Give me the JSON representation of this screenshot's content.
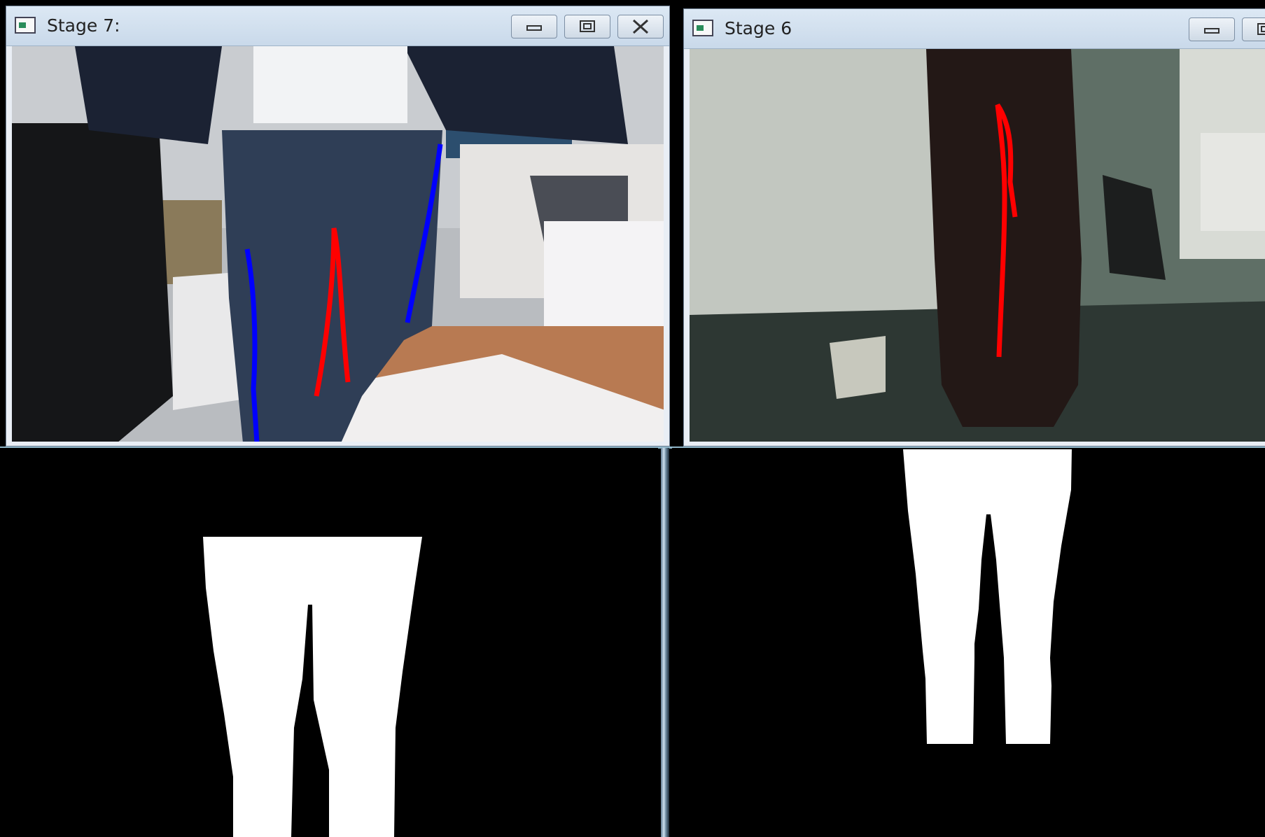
{
  "windows": [
    {
      "id": "stage7",
      "title": "Stage 7:",
      "controls": [
        "minimize",
        "maximize",
        "close"
      ]
    },
    {
      "id": "stage6",
      "title": "Stage 6",
      "controls": [
        "minimize",
        "maximize"
      ]
    }
  ],
  "colors": {
    "inner_leg_contour": "#ff0000",
    "outer_leg_contour": "#0000ff",
    "mask_foreground": "#ffffff",
    "mask_background": "#000000"
  },
  "icons": {
    "app": "window-app-icon",
    "minimize": "minimize-icon",
    "maximize": "maximize-icon",
    "close": "close-icon"
  }
}
